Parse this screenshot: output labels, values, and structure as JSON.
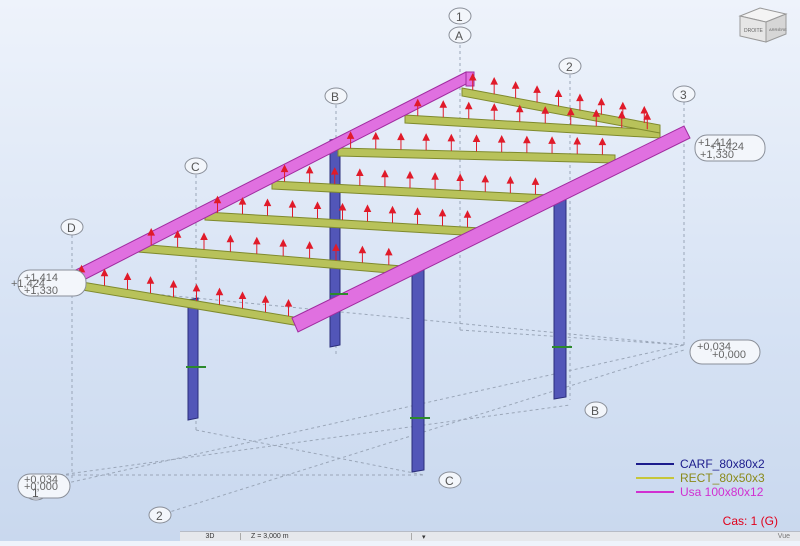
{
  "viewport": {
    "axis_labels": {
      "top_1": "1",
      "top_A": "A",
      "mid_2": "2",
      "mid_3": "3",
      "left_B": "B",
      "left_C": "C",
      "left_D": "D",
      "bottom_B": "B",
      "bottom_C": "C",
      "bottom_2": "2",
      "bottom_1": "1"
    },
    "level_labels": {
      "right_top_a": "+1,414",
      "right_top_b": "+1,424",
      "right_top_c": "+1,330",
      "left_a": "+1,414",
      "left_b": "+1,424",
      "left_c": "+1,330",
      "right_mid_a": "+0,034",
      "right_mid_b": "+0,000",
      "bottom_left_a": "+0,034",
      "bottom_left_b": "+0,000"
    }
  },
  "viewcube": {
    "face_front": "DROITE",
    "face_right": "ARRIÈRE"
  },
  "legend": {
    "items": [
      {
        "label": "CARF_80x80x2",
        "color": "#1c1c8c"
      },
      {
        "label": "RECT_80x50x3",
        "color": "#c6c63a"
      },
      {
        "label": "Usa 100x80x12",
        "color": "#d12fd1"
      }
    ]
  },
  "case": {
    "label": "Cas: 1 (G)"
  },
  "statusbar": {
    "view": "3D",
    "z_value": "Z = 3,000 m",
    "right": "Vue"
  }
}
